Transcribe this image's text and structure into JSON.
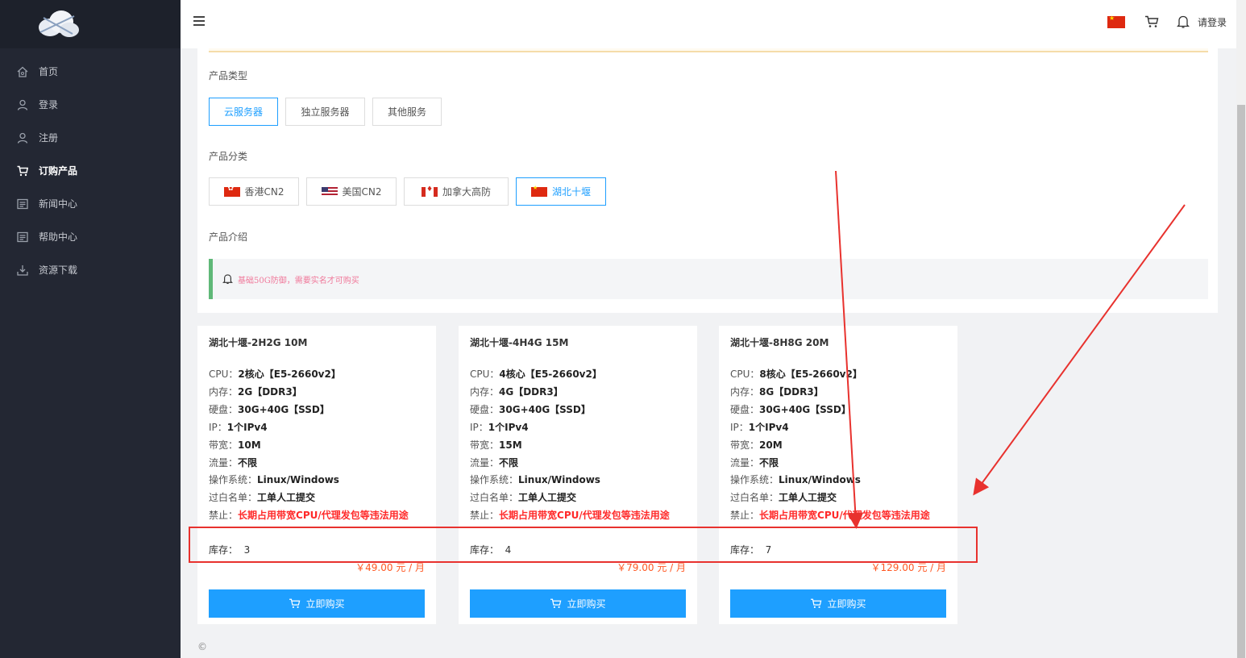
{
  "sidebar": {
    "items": [
      {
        "label": "首页",
        "icon": "home-icon"
      },
      {
        "label": "登录",
        "icon": "user-icon"
      },
      {
        "label": "注册",
        "icon": "user-plus-icon"
      },
      {
        "label": "订购产品",
        "icon": "cart-icon",
        "active": true
      },
      {
        "label": "新闻中心",
        "icon": "news-icon"
      },
      {
        "label": "帮助中心",
        "icon": "help-icon"
      },
      {
        "label": "资源下载",
        "icon": "download-icon"
      }
    ]
  },
  "header": {
    "login_text": "请登录"
  },
  "filters": {
    "product_type_label": "产品类型",
    "product_types": [
      "云服务器",
      "独立服务器",
      "其他服务"
    ],
    "category_label": "产品分类",
    "categories": [
      "香港CN2",
      "美国CN2",
      "加拿大高防",
      "湖北十堰"
    ],
    "intro_label": "产品介绍",
    "notice_text": "基础50G防御，需要实名才可购买"
  },
  "spec_labels": {
    "cpu": "CPU：",
    "mem": "内存：",
    "disk": "硬盘：",
    "ip": "IP：",
    "bw": "带宽：",
    "traffic": "流量：",
    "os": "操作系统：",
    "whitelist": "过白名单：",
    "ban": "禁止：",
    "stock": "库存："
  },
  "products": [
    {
      "title": "湖北十堰-2H2G 10M",
      "cpu": "2核心【E5-2660v2】",
      "mem": "2G【DDR3】",
      "disk": "30G+40G【SSD】",
      "ip": "1个IPv4",
      "bw": "10M",
      "traffic": "不限",
      "os": "Linux/Windows",
      "whitelist": "工单人工提交",
      "ban": "长期占用带宽CPU/代理发包等违法用途",
      "stock": "3",
      "price": "￥49.00 元 / 月",
      "buy_label": "立即购买"
    },
    {
      "title": "湖北十堰-4H4G 15M",
      "cpu": "4核心【E5-2660v2】",
      "mem": "4G【DDR3】",
      "disk": "30G+40G【SSD】",
      "ip": "1个IPv4",
      "bw": "15M",
      "traffic": "不限",
      "os": "Linux/Windows",
      "whitelist": "工单人工提交",
      "ban": "长期占用带宽CPU/代理发包等违法用途",
      "stock": "4",
      "price": "￥79.00 元 / 月",
      "buy_label": "立即购买"
    },
    {
      "title": "湖北十堰-8H8G 20M",
      "cpu": "8核心【E5-2660v2】",
      "mem": "8G【DDR3】",
      "disk": "30G+40G【SSD】",
      "ip": "1个IPv4",
      "bw": "20M",
      "traffic": "不限",
      "os": "Linux/Windows",
      "whitelist": "工单人工提交",
      "ban": "长期占用带宽CPU/代理发包等违法用途",
      "stock": "7",
      "price": "￥129.00 元 / 月",
      "buy_label": "立即购买"
    }
  ],
  "footer": {
    "copyright": "©"
  },
  "colors": {
    "accent": "#1e9fff",
    "sidebar_bg": "#232733",
    "warning_red": "#ff2a2a",
    "price": "#ff5722",
    "annotation": "#e8322e"
  }
}
